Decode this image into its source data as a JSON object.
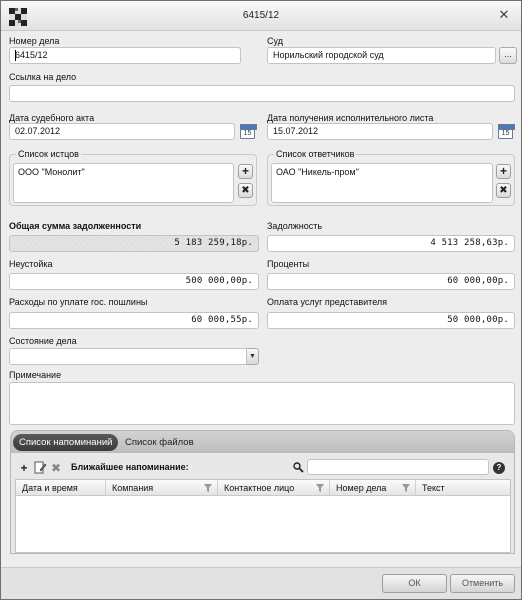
{
  "window": {
    "title": "6415/12",
    "close_glyph": "✕"
  },
  "case": {
    "number_label": "Номер дела",
    "number_value": "6415/12",
    "court_label": "Суд",
    "court_value": "Норильский городской суд",
    "court_button": "...",
    "link_label": "Ссылка на дело",
    "link_value": "",
    "act_date_label": "Дата судебного акта",
    "act_date_value": "02.07.2012",
    "writ_date_label": "Дата получения исполнительного листа",
    "writ_date_value": "15.07.2012",
    "calendar_day": "15"
  },
  "plaintiffs": {
    "label": "Список истцов",
    "items": [
      "ООО \"Монолит\""
    ]
  },
  "defendants": {
    "label": "Список ответчиков",
    "items": [
      "ОАО \"Никель-пром\""
    ]
  },
  "amounts": {
    "total_label": "Общая сумма задолженности",
    "total_value": "5 183 259,18р.",
    "debt_label": "Задолжность",
    "debt_value": "4 513 258,63р.",
    "penalty_label": "Неустойка",
    "penalty_value": "500 000,00р.",
    "interest_label": "Проценты",
    "interest_value": "60 000,00р.",
    "duty_label": "Расходы по уплате гос. пошлины",
    "duty_value": "60 000,55р.",
    "representative_label": "Оплата услуг представителя",
    "representative_value": "50 000,00р."
  },
  "status": {
    "label": "Состояние дела",
    "value": ""
  },
  "note": {
    "label": "Примечание",
    "value": ""
  },
  "tabs": [
    {
      "label": "Список напоминаний",
      "active": true
    },
    {
      "label": "Список файлов",
      "active": false
    }
  ],
  "reminders": {
    "nearest_label": "Ближайшее напоминание:",
    "search_value": "",
    "columns": [
      "Дата и время",
      "Компания",
      "Контактное лицо",
      "Номер дела",
      "Текст"
    ],
    "rows": []
  },
  "buttons": {
    "ok": "ОК",
    "cancel": "Отменить"
  },
  "colors": {
    "window_bg": "#ededed",
    "active_tab": "#3a3a3a",
    "calendar_accent": "#4b78b7"
  }
}
